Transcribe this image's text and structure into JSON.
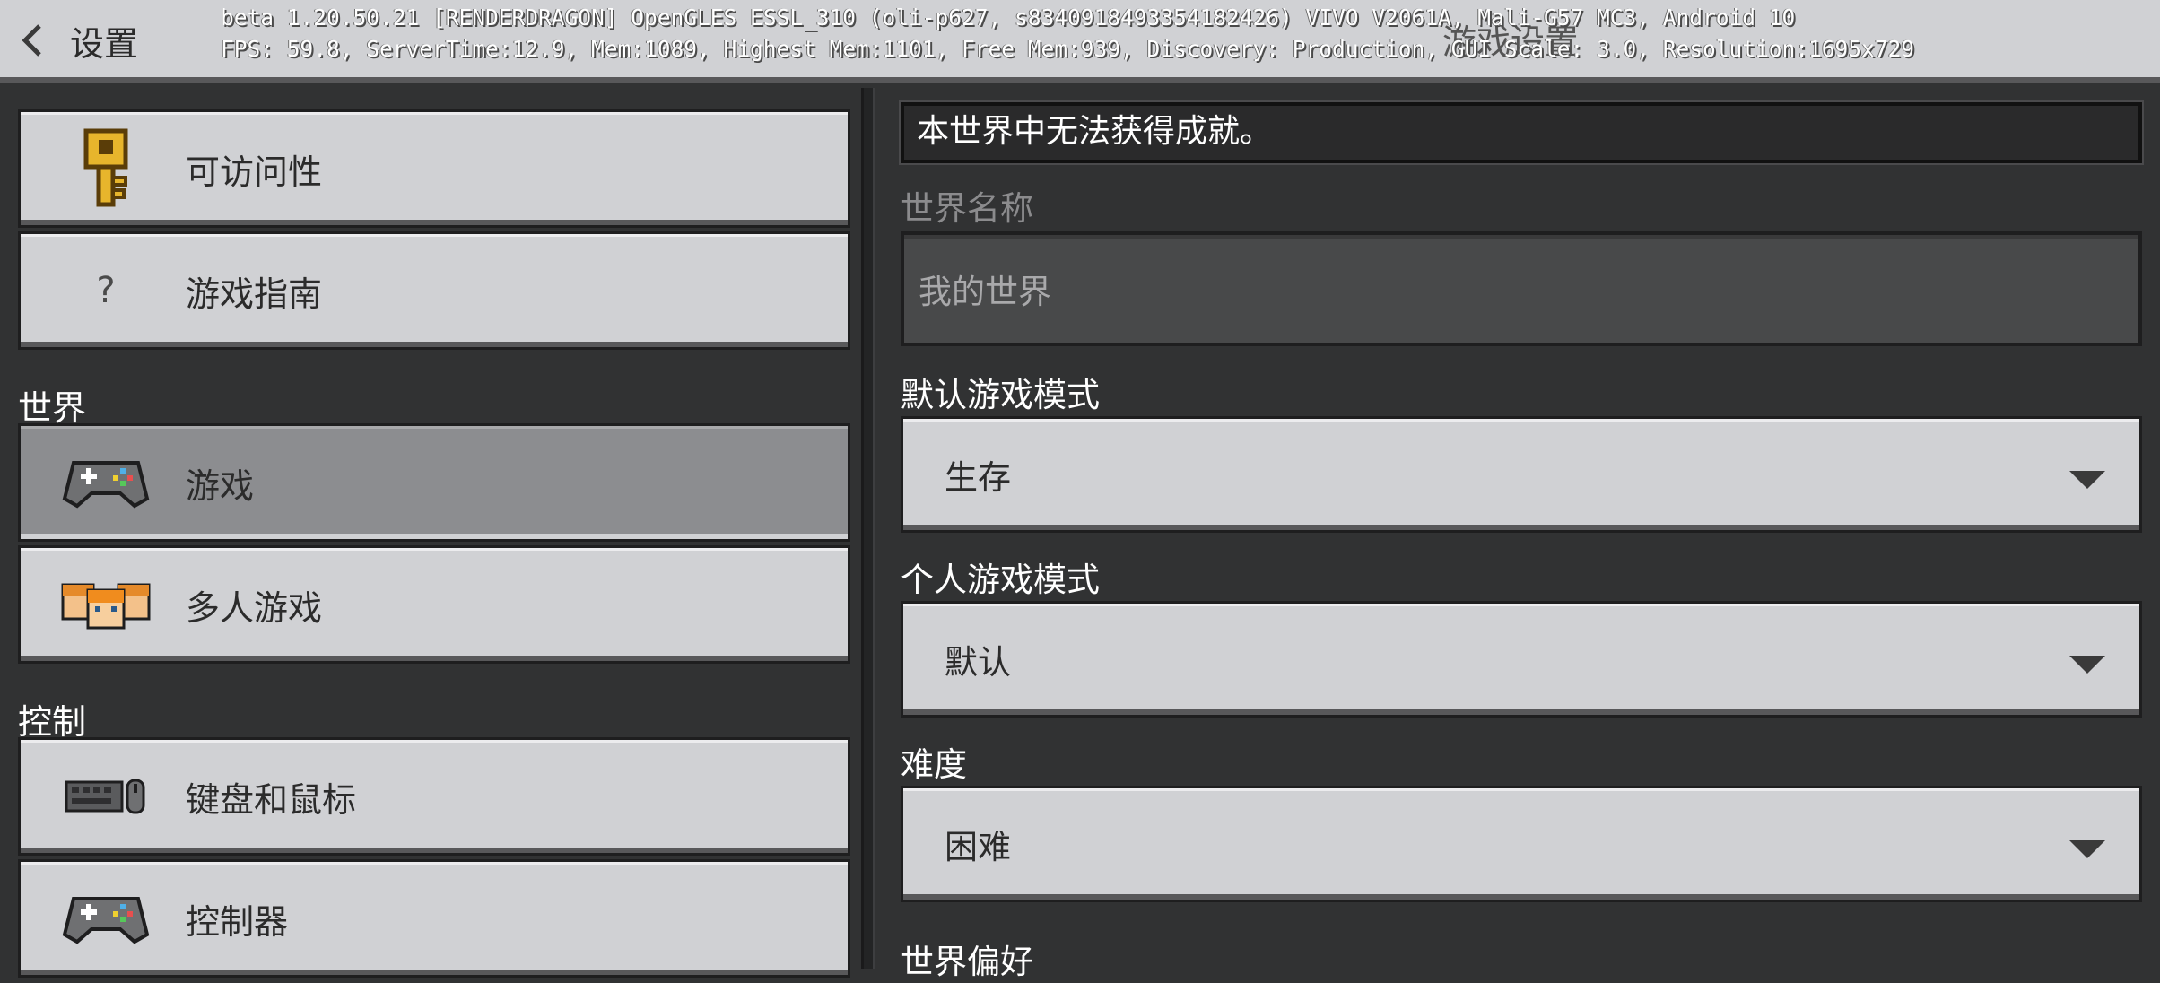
{
  "header": {
    "back_label": "设置",
    "title": "游戏设置",
    "debug_line1": "beta 1.20.50.21 [RENDERDRAGON] OpenGLES ESSL_310 (oli-p627, s8340918493354182426) VIVO V2061A, Mali-G57 MC3, Android 10",
    "debug_line2": "FPS: 59.8, ServerTime:12.9, Mem:1089, Highest Mem:1101, Free Mem:939, Discovery: Production, GUI Scale: 3.0, Resolution:1695x729"
  },
  "sidebar": {
    "top_items": [
      {
        "label": "可访问性",
        "icon": "key-icon"
      },
      {
        "label": "游戏指南",
        "icon": "question-mark-icon",
        "glyph": "?"
      }
    ],
    "sections": [
      {
        "heading": "世界",
        "items": [
          {
            "label": "游戏",
            "icon": "gamepad-icon",
            "selected": true
          },
          {
            "label": "多人游戏",
            "icon": "multiplayer-icon"
          }
        ]
      },
      {
        "heading": "控制",
        "items": [
          {
            "label": "键盘和鼠标",
            "icon": "keyboard-mouse-icon"
          },
          {
            "label": "控制器",
            "icon": "controller-icon"
          }
        ]
      }
    ]
  },
  "main": {
    "notice": "本世界中无法获得成就。",
    "world_name": {
      "label": "世界名称",
      "value": "我的世界"
    },
    "default_game_mode": {
      "label": "默认游戏模式",
      "value": "生存"
    },
    "personal_game_mode": {
      "label": "个人游戏模式",
      "value": "默认"
    },
    "difficulty": {
      "label": "难度",
      "value": "困难"
    },
    "world_preferences_label": "世界偏好"
  },
  "colors": {
    "background": "#313233",
    "button": "#d0d1d4",
    "button_selected": "#8c8d90",
    "text_dark": "#2b2b2b",
    "text_light": "#ffffff"
  }
}
